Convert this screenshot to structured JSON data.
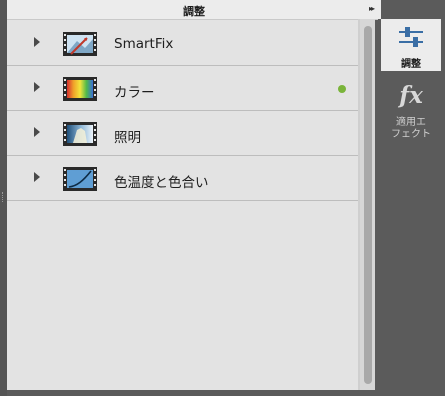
{
  "header": {
    "title": "調整",
    "collapse_glyph": "▸▸"
  },
  "adjustments": [
    {
      "label": "SmartFix",
      "icon": "smartfix-film-icon",
      "active": false
    },
    {
      "label": "カラー",
      "icon": "color-film-icon",
      "active": true
    },
    {
      "label": "照明",
      "icon": "lighting-film-icon",
      "active": false
    },
    {
      "label": "色温度と色合い",
      "icon": "temperature-film-icon",
      "active": false
    }
  ],
  "tabs": {
    "adjust_label": "調整",
    "effects_glyph": "fx",
    "effects_label": "適用エ\nフェクト"
  },
  "colors": {
    "active_dot": "#7ab43a",
    "panel_bg": "#e3e3e3",
    "tab_bg": "#5b5b5b"
  }
}
